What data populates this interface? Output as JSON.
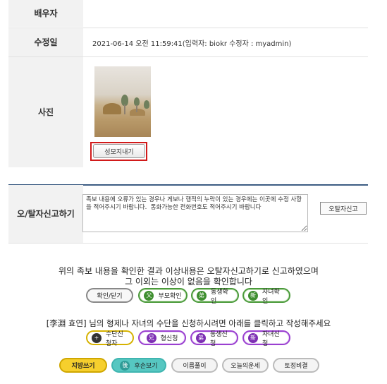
{
  "rows": {
    "spouse": {
      "label": "배우자",
      "value": ""
    },
    "modified": {
      "label": "수정일",
      "value": "2021-06-14 오전 11:59:41(입력자: biokr 수정자 : myadmin)"
    },
    "photo": {
      "label": "사진",
      "memorial_button": "성모지내기"
    }
  },
  "report": {
    "label_line1": "오/탈자",
    "label_line2": "신고하기",
    "textarea_value": "족보 내용에 오류가 있는 경우나 게보나 행적의 누락이 있는 경우에는 이곳에 수정 사항을 적어주시기 바랍니다.  통화가능한 전화번호도 적어주시기 바랍니다",
    "button": "오탈자신고"
  },
  "notice": {
    "line1": "위의 족보 내용을 확인한 결과 이상내용은 오탈자신고하기로 신고하였으며",
    "line2": "그 이외는 이상이 없음을 확인합니다"
  },
  "confirm_buttons": {
    "close": "확인/닫기",
    "parents": {
      "icon": "父",
      "label": "부모확인"
    },
    "siblings": {
      "icon": "弟",
      "label": "동생확인"
    },
    "children": {
      "icon": "新",
      "label": "자녀확인"
    }
  },
  "apply_notice": "[李淵 효연] 님의 형제나 자녀의 수단을 신청하시려면 아래를 클릭하고 작성해주세요",
  "apply_buttons": {
    "applicant": {
      "icon": "+",
      "label": "수단신청자"
    },
    "elder": {
      "icon": "兄",
      "label": "형신청"
    },
    "younger": {
      "icon": "弟",
      "label": "동생신청"
    },
    "child": {
      "icon": "新",
      "label": "자녀신청"
    }
  },
  "bottom_buttons": {
    "jibang": "지방쓰기",
    "descendants": {
      "icon": "後",
      "label": "후손보기"
    },
    "naming": "이름풀이",
    "fortune": "오늘의운세",
    "tojeong": "토정비결"
  },
  "colors": {
    "label_bg": "#f2f2f2",
    "accent_line": "#3d5d83",
    "highlight_border": "#d11a1a",
    "green": "#3f8f30",
    "purple": "#7d2fb3",
    "yellow": "#f6cf2d",
    "teal": "#56c7c1"
  }
}
